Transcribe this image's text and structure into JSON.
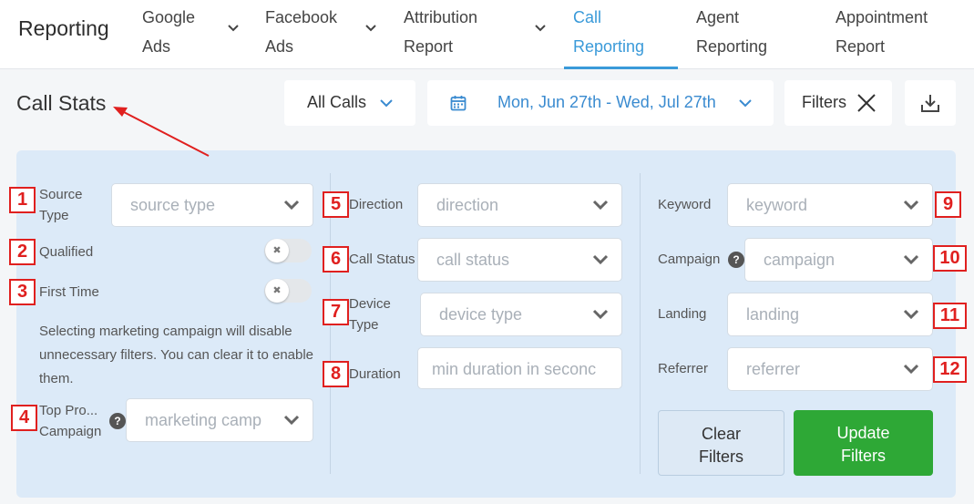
{
  "nav": {
    "brand": "Reporting",
    "items": [
      {
        "line1": "Google",
        "line2": "Ads"
      },
      {
        "line1": "Facebook",
        "line2": "Ads"
      },
      {
        "line1": "Attribution",
        "line2": "Report"
      },
      {
        "line1": "Call",
        "line2": "Reporting"
      },
      {
        "line1": "Agent",
        "line2": "Reporting"
      },
      {
        "line1": "Appointment",
        "line2": "Report"
      }
    ]
  },
  "header": {
    "title": "Call Stats",
    "all_calls": "All Calls",
    "date_range": "Mon, Jun 27th - Wed, Jul 27th",
    "filters": "Filters"
  },
  "filters": {
    "source_type": {
      "badge": "1",
      "label_line1": "Source",
      "label_line2": "Type",
      "placeholder": "source type"
    },
    "qualified": {
      "badge": "2",
      "label": "Qualified"
    },
    "first_time": {
      "badge": "3",
      "label": "First Time"
    },
    "note_lines": [
      "Selecting marketing campaign will disable",
      "unnecessary filters. You can clear it to enable",
      "them."
    ],
    "top_campaign": {
      "badge": "4",
      "label_line1": "Top Pro...",
      "label_line2": "Campaign",
      "placeholder": "marketing camp"
    },
    "direction": {
      "badge": "5",
      "label": "Direction",
      "placeholder": "direction"
    },
    "call_status": {
      "badge": "6",
      "label": "Call Status",
      "placeholder": "call status"
    },
    "device_type": {
      "badge": "7",
      "label_line1": "Device",
      "label_line2": "Type",
      "placeholder": "device type"
    },
    "duration": {
      "badge": "8",
      "label": "Duration",
      "placeholder": "min duration in seconc"
    },
    "keyword": {
      "badge": "9",
      "label": "Keyword",
      "placeholder": "keyword"
    },
    "campaign": {
      "badge": "10",
      "label": "Campaign",
      "placeholder": "campaign"
    },
    "landing": {
      "badge": "11",
      "label": "Landing",
      "placeholder": "landing"
    },
    "referrer": {
      "badge": "12",
      "label": "Referrer",
      "placeholder": "referrer"
    }
  },
  "actions": {
    "clear_line1": "Clear",
    "clear_line2": "Filters",
    "update_line1": "Update",
    "update_line2": "Filters"
  },
  "colors": {
    "accent": "#3a9ad9",
    "annotation": "#e0201f",
    "update": "#2ea836",
    "panel": "#dceaf8"
  }
}
